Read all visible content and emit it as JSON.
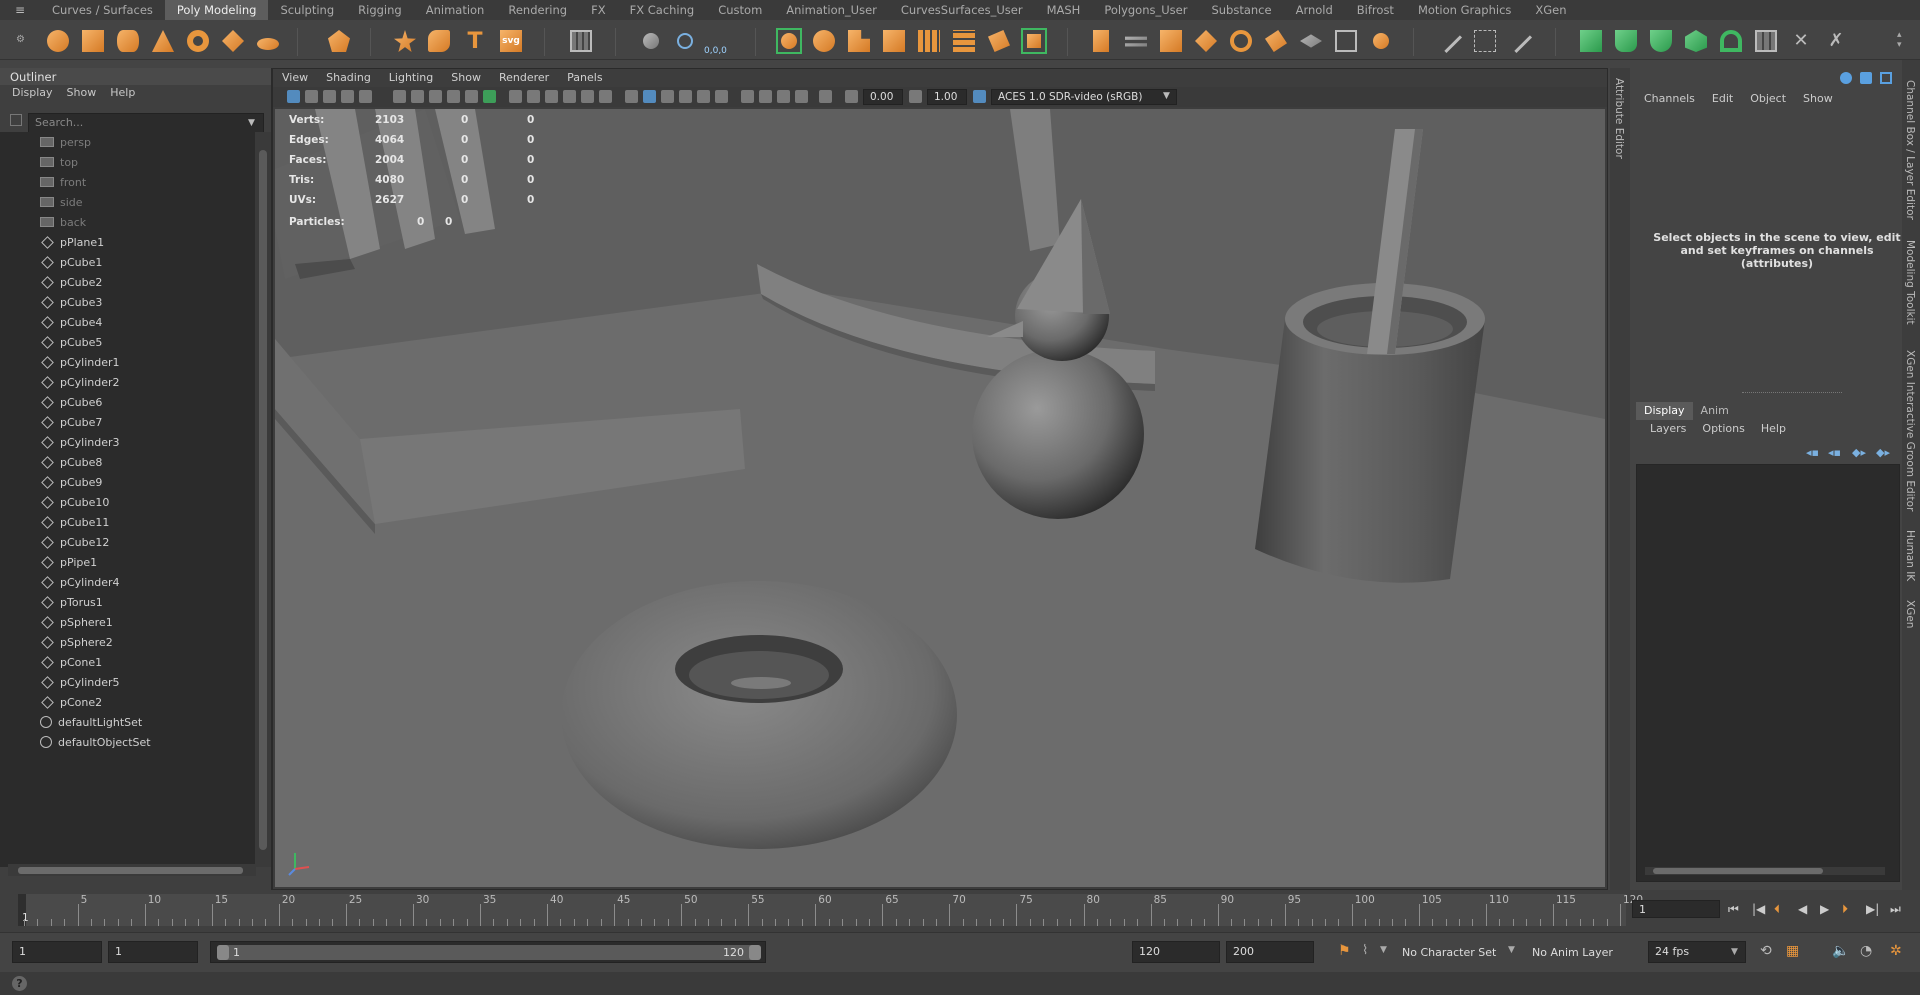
{
  "shelf": {
    "tabs": [
      "Curves / Surfaces",
      "Poly Modeling",
      "Sculpting",
      "Rigging",
      "Animation",
      "Rendering",
      "FX",
      "FX Caching",
      "Custom",
      "Animation_User",
      "CurvesSurfaces_User",
      "MASH",
      "Polygons_User",
      "Substance",
      "Arnold",
      "Bifrost",
      "Motion Graphics",
      "XGen"
    ],
    "active_tab": "Poly Modeling",
    "svg_label": "svg",
    "text_tool_label": "T",
    "coord_label": "0,0,0",
    "accent_orange": "#e8963d",
    "accent_green": "#3fb861"
  },
  "outliner": {
    "title": "Outliner",
    "menu": [
      "Display",
      "Show",
      "Help"
    ],
    "search_placeholder": "Search...",
    "cameras": [
      "persp",
      "top",
      "front",
      "side",
      "back"
    ],
    "items": [
      "pPlane1",
      "pCube1",
      "pCube2",
      "pCube3",
      "pCube4",
      "pCube5",
      "pCylinder1",
      "pCylinder2",
      "pCube6",
      "pCube7",
      "pCylinder3",
      "pCube8",
      "pCube9",
      "pCube10",
      "pCube11",
      "pCube12",
      "pPipe1",
      "pCylinder4",
      "pTorus1",
      "pSphere1",
      "pSphere2",
      "pCone1",
      "pCylinder5",
      "pCone2"
    ],
    "sets": [
      "defaultLightSet",
      "defaultObjectSet"
    ]
  },
  "viewport": {
    "menu": [
      "View",
      "Shading",
      "Lighting",
      "Show",
      "Renderer",
      "Panels"
    ],
    "exposure": "0.00",
    "gamma": "1.00",
    "color_space": "ACES 1.0 SDR-video (sRGB)",
    "hud": {
      "rows": [
        {
          "label": "Verts:",
          "v1": "2103",
          "v2": "0",
          "v3": "0"
        },
        {
          "label": "Edges:",
          "v1": "4064",
          "v2": "0",
          "v3": "0"
        },
        {
          "label": "Faces:",
          "v1": "2004",
          "v2": "0",
          "v3": "0"
        },
        {
          "label": "Tris:",
          "v1": "4080",
          "v2": "0",
          "v3": "0"
        },
        {
          "label": "UVs:",
          "v1": "2627",
          "v2": "0",
          "v3": "0"
        }
      ],
      "particles_label": "Particles:",
      "particles_v1": "0",
      "particles_v2": "0"
    },
    "background_color": "#6d6d6d"
  },
  "attribute_editor": {
    "tab_label": "Attribute Editor"
  },
  "channel_box": {
    "menu": [
      "Channels",
      "Edit",
      "Object",
      "Show"
    ],
    "message": "Select objects in the scene to view, edit and set keyframes on channels (attributes)",
    "layer_tabs": [
      "Display",
      "Anim"
    ],
    "layer_menu": [
      "Layers",
      "Options",
      "Help"
    ]
  },
  "right_tabs": [
    "Channel Box / Layer Editor",
    "Modeling Toolkit",
    "XGen Interactive Groom Editor",
    "Human IK",
    "XGen"
  ],
  "timeline": {
    "ticks": [
      "5",
      "10",
      "15",
      "20",
      "25",
      "30",
      "35",
      "40",
      "45",
      "50",
      "55",
      "60",
      "65",
      "70",
      "75",
      "80",
      "85",
      "90",
      "95",
      "100",
      "105",
      "110",
      "115",
      "120"
    ],
    "start_label": "1",
    "current_frame": "1"
  },
  "range": {
    "start_time": "1",
    "playback_start": "1",
    "slider_start": "1",
    "slider_end": "120",
    "playback_end": "120",
    "end_time": "200",
    "character_set": "No Character Set",
    "anim_layer": "No Anim Layer",
    "fps": "24 fps"
  },
  "helpline": {
    "icon": "?"
  }
}
